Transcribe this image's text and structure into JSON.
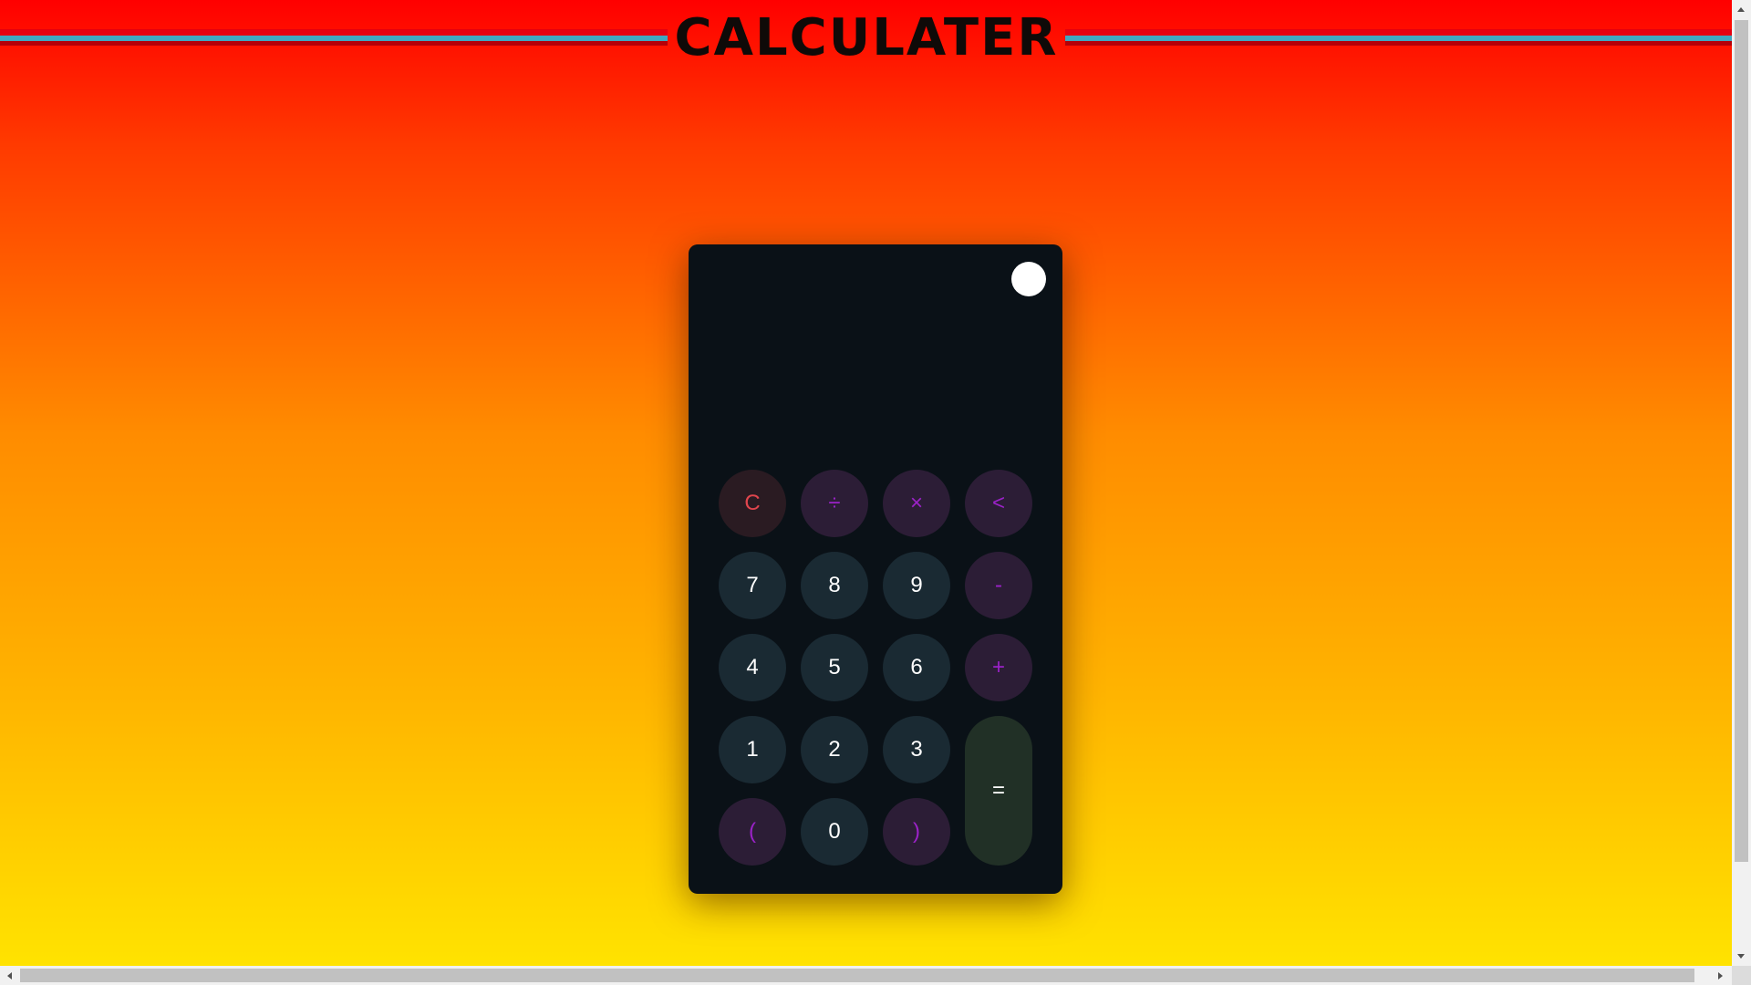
{
  "page": {
    "title": "CALCULATER",
    "background_gradient": [
      "#ff0000",
      "#ff3a00",
      "#ff8c00",
      "#ffb400",
      "#ffe300"
    ],
    "title_color": "#0f0a08",
    "title_line_accent": "#3fa7c0"
  },
  "calculator": {
    "body_color": "#0a1117",
    "display_value": "",
    "theme_toggle_color": "#ffffff",
    "keys": [
      {
        "label": "C",
        "kind": "clear",
        "bg": "#2a1b22",
        "fg": "#e0454d"
      },
      {
        "label": "÷",
        "kind": "operator",
        "bg": "#2c1d36",
        "fg": "#9b22c8"
      },
      {
        "label": "×",
        "kind": "operator",
        "bg": "#2c1d36",
        "fg": "#9b22c8"
      },
      {
        "label": "<",
        "kind": "backspace",
        "bg": "#2c1d36",
        "fg": "#9b22c8"
      },
      {
        "label": "7",
        "kind": "digit",
        "bg": "#1a2a33",
        "fg": "#ffffff"
      },
      {
        "label": "8",
        "kind": "digit",
        "bg": "#1a2a33",
        "fg": "#ffffff"
      },
      {
        "label": "9",
        "kind": "digit",
        "bg": "#1a2a33",
        "fg": "#ffffff"
      },
      {
        "label": "-",
        "kind": "operator",
        "bg": "#2c1d36",
        "fg": "#9b22c8"
      },
      {
        "label": "4",
        "kind": "digit",
        "bg": "#1a2a33",
        "fg": "#ffffff"
      },
      {
        "label": "5",
        "kind": "digit",
        "bg": "#1a2a33",
        "fg": "#ffffff"
      },
      {
        "label": "6",
        "kind": "digit",
        "bg": "#1a2a33",
        "fg": "#ffffff"
      },
      {
        "label": "+",
        "kind": "operator",
        "bg": "#2c1d36",
        "fg": "#9b22c8"
      },
      {
        "label": "1",
        "kind": "digit",
        "bg": "#1a2a33",
        "fg": "#ffffff"
      },
      {
        "label": "2",
        "kind": "digit",
        "bg": "#1a2a33",
        "fg": "#ffffff"
      },
      {
        "label": "3",
        "kind": "digit",
        "bg": "#1a2a33",
        "fg": "#ffffff"
      },
      {
        "label": "=",
        "kind": "equals",
        "bg": "#213026",
        "fg": "#ffffff"
      },
      {
        "label": "(",
        "kind": "paren",
        "bg": "#2c1d36",
        "fg": "#9b22c8"
      },
      {
        "label": "0",
        "kind": "digit",
        "bg": "#1a2a33",
        "fg": "#ffffff"
      },
      {
        "label": ")",
        "kind": "paren",
        "bg": "#2c1d36",
        "fg": "#9b22c8"
      }
    ]
  }
}
